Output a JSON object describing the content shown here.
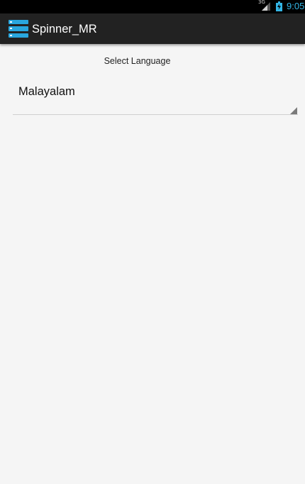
{
  "status_bar": {
    "network_type": "3G",
    "time": "9:05",
    "signal_icon": "signal-bars-icon",
    "battery_icon": "battery-charging-icon",
    "accent_color": "#33b5e5"
  },
  "action_bar": {
    "title": "Spinner_MR",
    "app_icon": "app-launcher-icon",
    "background": "#222222"
  },
  "content": {
    "prompt_label": "Select Language",
    "spinner": {
      "selected_value": "Malayalam",
      "arrow_icon": "dropdown-triangle-icon"
    }
  }
}
